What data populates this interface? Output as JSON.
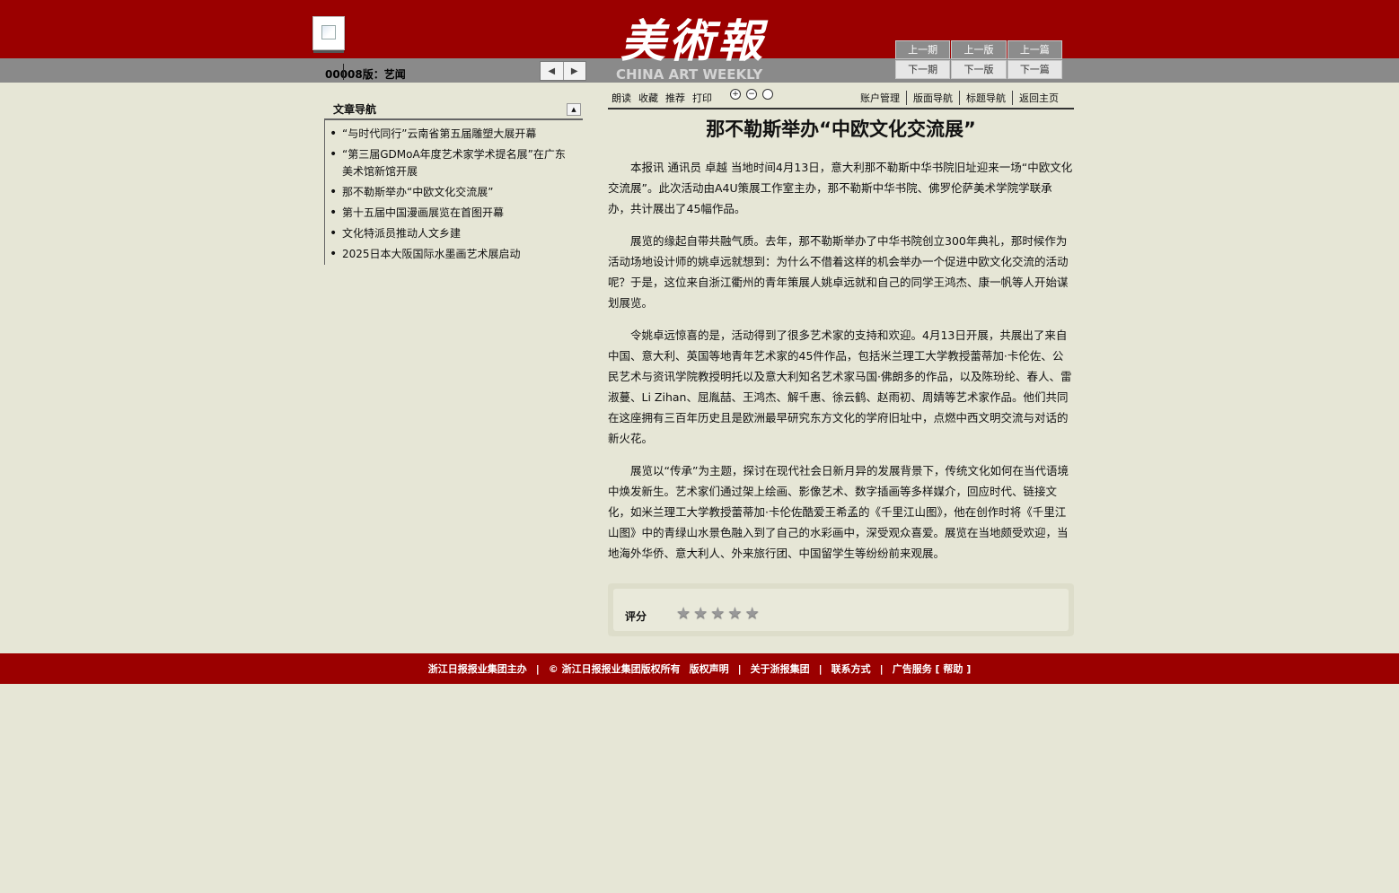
{
  "header": {
    "logo_cn": "美術報",
    "logo_en": "CHINA ART WEEKLY",
    "edition": "00008版：艺闻",
    "pager_prev": "◀",
    "pager_next": "▶",
    "nav": {
      "prev_issue": "上一期",
      "prev_page": "上一版",
      "prev_article": "上一篇",
      "next_issue": "下一期",
      "next_page": "下一版",
      "next_article": "下一篇"
    }
  },
  "sidebar": {
    "title": "文章导航",
    "collapse_icon": "▲",
    "items": [
      "“与时代同行”云南省第五届雕塑大展开幕",
      "“第三届GDMoA年度艺术家学术提名展”在广东美术馆新馆开展",
      "那不勒斯举办“中欧文化交流展”",
      "第十五届中国漫画展览在首图开幕",
      "文化特派员推动人文乡建",
      "2025日本大阪国际水墨画艺术展启动"
    ]
  },
  "toolbar": {
    "read": "朗读",
    "favorite": "收藏",
    "recommend": "推荐",
    "print": "打印",
    "zoom_in": "+",
    "zoom_out": "−",
    "zoom_reset": "",
    "account": "账户管理",
    "page_nav": "版面导航",
    "title_nav": "标题导航",
    "home": "返回主页"
  },
  "article": {
    "title": "那不勒斯举办“中欧文化交流展”",
    "paragraphs": [
      "本报讯 通讯员 卓越 当地时间4月13日，意大利那不勒斯中华书院旧址迎来一场“中欧文化交流展”。此次活动由A4U策展工作室主办，那不勒斯中华书院、佛罗伦萨美术学院学联承办，共计展出了45幅作品。",
      "展览的缘起自带共融气质。去年，那不勒斯举办了中华书院创立300年典礼，那时候作为活动场地设计师的姚卓远就想到：为什么不借着这样的机会举办一个促进中欧文化交流的活动呢？于是，这位来自浙江衢州的青年策展人姚卓远就和自己的同学王鸿杰、康一帆等人开始谋划展览。",
      "令姚卓远惊喜的是，活动得到了很多艺术家的支持和欢迎。4月13日开展，共展出了来自中国、意大利、英国等地青年艺术家的45件作品，包括米兰理工大学教授蕾蒂加·卡伦佐、公民艺术与资讯学院教授明托以及意大利知名艺术家马国·佛朗多的作品，以及陈玢纶、春人、雷淑蔓、Li Zihan、屈胤喆、王鸿杰、解千惠、徐云鹤、赵雨初、周婧等艺术家作品。他们共同在这座拥有三百年历史且是欧洲最早研究东方文化的学府旧址中，点燃中西文明交流与对话的新火花。",
      "展览以“传承”为主题，探讨在现代社会日新月异的发展背景下，传统文化如何在当代语境中焕发新生。艺术家们通过架上绘画、影像艺术、数字插画等多样媒介，回应时代、链接文化，如米兰理工大学教授蕾蒂加·卡伦佐酷爱王希孟的《千里江山图》，他在创作时将《千里江山图》中的青绿山水景色融入到了自己的水彩画中，深受观众喜爱。展览在当地颇受欢迎，当地海外华侨、意大利人、外来旅行团、中国留学生等纷纷前来观展。"
    ]
  },
  "rating": {
    "label": "评分",
    "star_icon": "★",
    "stars_filled": 0,
    "stars_total": 5
  },
  "footer": {
    "host": "浙江日报报业集团主办",
    "sep": "|",
    "copyright": "© 浙江日报报业集团版权所有",
    "rights": "版权声明",
    "about": "关于浙报集团",
    "contact": "联系方式",
    "ads": "广告服务 [ 帮助 ]"
  }
}
